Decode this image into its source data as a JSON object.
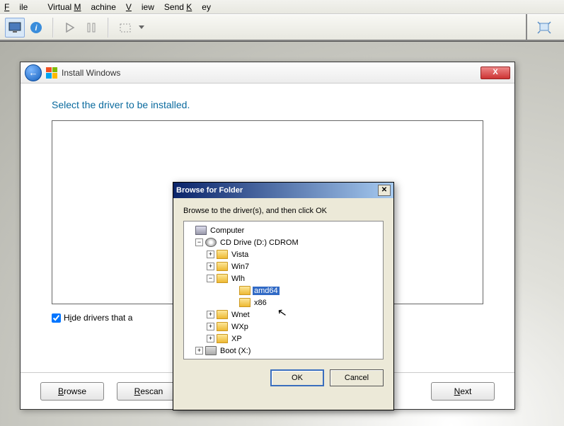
{
  "host_menu": {
    "file": "File",
    "vm": "Virtual Machine",
    "view": "View",
    "sendkey": "Send Key"
  },
  "wizard": {
    "title": "Install Windows",
    "heading": "Select the driver to be installed.",
    "hide_label": "Hide drivers that are not compatible with hardware on this computer.",
    "browse": "Browse",
    "rescan": "Rescan",
    "next": "Next"
  },
  "browse": {
    "title": "Browse for Folder",
    "instruction": "Browse to the driver(s), and then click OK",
    "ok": "OK",
    "cancel": "Cancel",
    "tree": {
      "computer": "Computer",
      "cd": "CD Drive (D:) CDROM",
      "vista": "Vista",
      "win7": "Win7",
      "wlh": "Wlh",
      "amd64": "amd64",
      "x86": "x86",
      "wnet": "Wnet",
      "wxp": "WXp",
      "xp": "XP",
      "boot": "Boot (X:)"
    }
  }
}
